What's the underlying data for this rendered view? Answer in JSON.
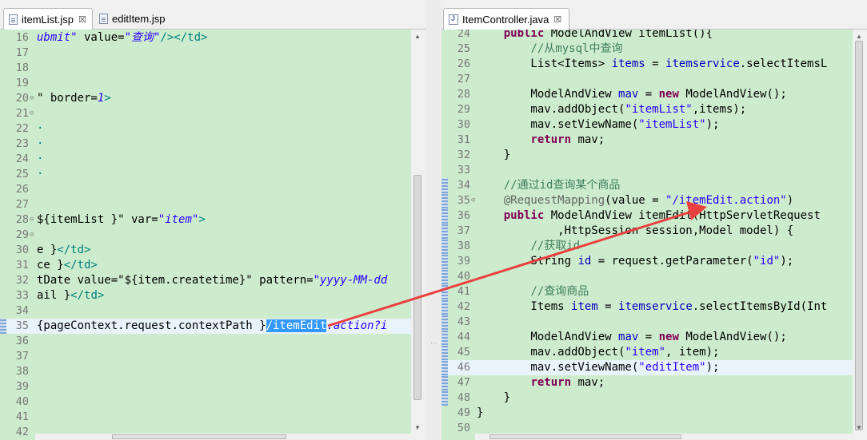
{
  "left_tabs": [
    {
      "label": "itemList.jsp",
      "close": "☒"
    },
    {
      "label": "editItem.jsp"
    }
  ],
  "right_tabs": [
    {
      "label": "ItemController.java",
      "close": "☒"
    }
  ],
  "colors": {
    "editor_bg": "#cdeccd",
    "selection": "#3399ff",
    "arrow": "#e8413f",
    "keyword": "#7f0055",
    "string": "#2a00ff",
    "comment": "#3f7f5f"
  },
  "left_lines": [
    {
      "n": "16",
      "parts": [
        {
          "t": "ubmit\"",
          "c": "ital"
        },
        {
          "t": " value=",
          "c": ""
        },
        {
          "t": "\"查询\"",
          "c": "ital"
        },
        {
          "t": "/></td>",
          "c": "tag"
        }
      ]
    },
    {
      "n": "17",
      "parts": []
    },
    {
      "n": "18",
      "parts": []
    },
    {
      "n": "19",
      "parts": []
    },
    {
      "n": "20",
      "fold": "⊖",
      "parts": [
        {
          "t": "\" border=",
          "c": ""
        },
        {
          "t": "1",
          "c": "ital"
        },
        {
          "t": ">",
          "c": "tag"
        }
      ]
    },
    {
      "n": "21",
      "fold": "⊖",
      "parts": []
    },
    {
      "n": "22",
      "parts": [
        {
          "t": "·",
          "c": "tag"
        }
      ]
    },
    {
      "n": "23",
      "parts": [
        {
          "t": "·",
          "c": "tag"
        }
      ]
    },
    {
      "n": "24",
      "parts": [
        {
          "t": "·",
          "c": "tag"
        }
      ]
    },
    {
      "n": "25",
      "parts": [
        {
          "t": "·",
          "c": "tag"
        }
      ]
    },
    {
      "n": "26",
      "parts": []
    },
    {
      "n": "27",
      "parts": []
    },
    {
      "n": "28",
      "fold": "⊖",
      "parts": [
        {
          "t": "${itemList }\"",
          "c": ""
        },
        {
          "t": " var=",
          "c": ""
        },
        {
          "t": "\"item\"",
          "c": "ital"
        },
        {
          "t": ">",
          "c": "tag"
        }
      ]
    },
    {
      "n": "29",
      "fold": "⊖",
      "parts": []
    },
    {
      "n": "30",
      "parts": [
        {
          "t": "e }",
          "c": ""
        },
        {
          "t": "</td>",
          "c": "tag"
        }
      ]
    },
    {
      "n": "31",
      "parts": [
        {
          "t": "ce }",
          "c": ""
        },
        {
          "t": "</td>",
          "c": "tag"
        }
      ]
    },
    {
      "n": "32",
      "parts": [
        {
          "t": "tDate value=\"${item.createtime}\" pattern=",
          "c": ""
        },
        {
          "t": "\"yyyy-MM-dd",
          "c": "ital"
        }
      ]
    },
    {
      "n": "33",
      "parts": [
        {
          "t": "ail }",
          "c": ""
        },
        {
          "t": "</td>",
          "c": "tag"
        }
      ]
    },
    {
      "n": "34",
      "parts": []
    },
    {
      "n": "35",
      "marker": true,
      "hl": true,
      "parts": [
        {
          "t": "{pageContext.request.contextPath }",
          "c": ""
        },
        {
          "t": "/itemEdit",
          "c": "sel"
        },
        {
          "t": ".action?i",
          "c": "ital"
        }
      ]
    },
    {
      "n": "36",
      "parts": []
    },
    {
      "n": "37",
      "parts": []
    },
    {
      "n": "38",
      "parts": []
    },
    {
      "n": "39",
      "parts": []
    },
    {
      "n": "40",
      "parts": []
    },
    {
      "n": "41",
      "parts": []
    },
    {
      "n": "42",
      "parts": []
    }
  ],
  "right_lines": [
    {
      "n": "24",
      "parts": [
        {
          "t": "    ",
          "c": ""
        },
        {
          "t": "public",
          "c": "kw"
        },
        {
          "t": " ModelAndView itemList(){",
          "c": ""
        }
      ]
    },
    {
      "n": "25",
      "parts": [
        {
          "t": "        ",
          "c": ""
        },
        {
          "t": "//从mysql中查询",
          "c": "cmt"
        }
      ]
    },
    {
      "n": "26",
      "parts": [
        {
          "t": "        List<Items> ",
          "c": ""
        },
        {
          "t": "items",
          "c": "fld"
        },
        {
          "t": " = ",
          "c": ""
        },
        {
          "t": "itemservice",
          "c": "fld"
        },
        {
          "t": ".selectItemsL",
          "c": ""
        }
      ]
    },
    {
      "n": "27",
      "parts": []
    },
    {
      "n": "28",
      "parts": [
        {
          "t": "        ModelAndView ",
          "c": ""
        },
        {
          "t": "mav",
          "c": "fld"
        },
        {
          "t": " = ",
          "c": ""
        },
        {
          "t": "new",
          "c": "kw"
        },
        {
          "t": " ModelAndView();",
          "c": ""
        }
      ]
    },
    {
      "n": "29",
      "parts": [
        {
          "t": "        mav.addObject(",
          "c": ""
        },
        {
          "t": "\"itemList\"",
          "c": "str"
        },
        {
          "t": ",items);",
          "c": ""
        }
      ]
    },
    {
      "n": "30",
      "parts": [
        {
          "t": "        mav.setViewName(",
          "c": ""
        },
        {
          "t": "\"itemList\"",
          "c": "str"
        },
        {
          "t": ");",
          "c": ""
        }
      ]
    },
    {
      "n": "31",
      "parts": [
        {
          "t": "        ",
          "c": ""
        },
        {
          "t": "return",
          "c": "kw"
        },
        {
          "t": " mav;",
          "c": ""
        }
      ]
    },
    {
      "n": "32",
      "parts": [
        {
          "t": "    }",
          "c": ""
        }
      ]
    },
    {
      "n": "33",
      "parts": []
    },
    {
      "n": "34",
      "marker": true,
      "parts": [
        {
          "t": "    ",
          "c": ""
        },
        {
          "t": "//通过id查询某个商品",
          "c": "cmt"
        }
      ]
    },
    {
      "n": "35",
      "marker": true,
      "fold": "⊖",
      "parts": [
        {
          "t": "    ",
          "c": ""
        },
        {
          "t": "@RequestMapping",
          "c": "ann"
        },
        {
          "t": "(value = ",
          "c": ""
        },
        {
          "t": "\"/itemEdit.action\"",
          "c": "str"
        },
        {
          "t": ")",
          "c": ""
        }
      ]
    },
    {
      "n": "36",
      "marker": true,
      "parts": [
        {
          "t": "    ",
          "c": ""
        },
        {
          "t": "public",
          "c": "kw"
        },
        {
          "t": " ModelAndView itemEdit(HttpServletRequest",
          "c": ""
        }
      ]
    },
    {
      "n": "37",
      "marker": true,
      "parts": [
        {
          "t": "            ,HttpSession session,Model model) {",
          "c": ""
        }
      ]
    },
    {
      "n": "38",
      "marker": true,
      "parts": [
        {
          "t": "        ",
          "c": ""
        },
        {
          "t": "//获取id",
          "c": "cmt"
        }
      ]
    },
    {
      "n": "39",
      "marker": true,
      "parts": [
        {
          "t": "        String ",
          "c": ""
        },
        {
          "t": "id",
          "c": "fld"
        },
        {
          "t": " = request.getParameter(",
          "c": ""
        },
        {
          "t": "\"id\"",
          "c": "str"
        },
        {
          "t": ");",
          "c": ""
        }
      ]
    },
    {
      "n": "40",
      "marker": true,
      "parts": []
    },
    {
      "n": "41",
      "marker": true,
      "parts": [
        {
          "t": "        ",
          "c": ""
        },
        {
          "t": "//查询商品",
          "c": "cmt"
        }
      ]
    },
    {
      "n": "42",
      "marker": true,
      "parts": [
        {
          "t": "        Items ",
          "c": ""
        },
        {
          "t": "item",
          "c": "fld"
        },
        {
          "t": " = ",
          "c": ""
        },
        {
          "t": "itemservice",
          "c": "fld"
        },
        {
          "t": ".selectItemsById(Int",
          "c": ""
        }
      ]
    },
    {
      "n": "43",
      "marker": true,
      "parts": []
    },
    {
      "n": "44",
      "marker": true,
      "parts": [
        {
          "t": "        ModelAndView ",
          "c": ""
        },
        {
          "t": "mav",
          "c": "fld"
        },
        {
          "t": " = ",
          "c": ""
        },
        {
          "t": "new",
          "c": "kw"
        },
        {
          "t": " ModelAndView();",
          "c": ""
        }
      ]
    },
    {
      "n": "45",
      "marker": true,
      "parts": [
        {
          "t": "        mav.addObject(",
          "c": ""
        },
        {
          "t": "\"item\"",
          "c": "str"
        },
        {
          "t": ", item);",
          "c": ""
        }
      ]
    },
    {
      "n": "46",
      "marker": true,
      "hl": true,
      "parts": [
        {
          "t": "        mav.setViewName(",
          "c": ""
        },
        {
          "t": "\"editItem\"",
          "c": "str"
        },
        {
          "t": ");",
          "c": ""
        }
      ]
    },
    {
      "n": "47",
      "marker": true,
      "parts": [
        {
          "t": "        ",
          "c": ""
        },
        {
          "t": "return",
          "c": "kw"
        },
        {
          "t": " mav;",
          "c": ""
        }
      ]
    },
    {
      "n": "48",
      "marker": true,
      "parts": [
        {
          "t": "    }",
          "c": ""
        }
      ]
    },
    {
      "n": "49",
      "parts": [
        {
          "t": "}",
          "c": ""
        }
      ]
    },
    {
      "n": "50",
      "parts": []
    }
  ]
}
